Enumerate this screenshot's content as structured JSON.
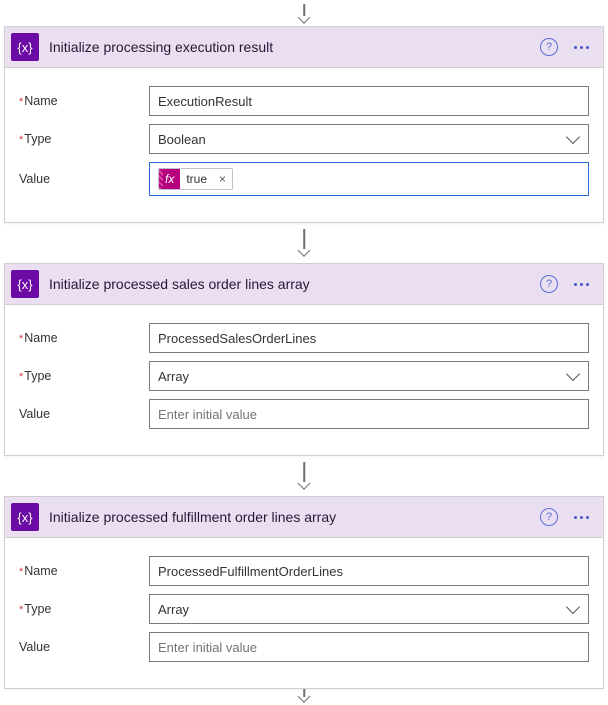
{
  "cards": [
    {
      "title": "Initialize processing execution result",
      "nameLabel": "Name",
      "nameValue": "ExecutionResult",
      "typeLabel": "Type",
      "typeValue": "Boolean",
      "valueLabel": "Value",
      "valueToken": {
        "fx": "fx",
        "text": "true",
        "close": "×"
      },
      "valuePlaceholder": "",
      "valueActive": true
    },
    {
      "title": "Initialize processed sales order lines array",
      "nameLabel": "Name",
      "nameValue": "ProcessedSalesOrderLines",
      "typeLabel": "Type",
      "typeValue": "Array",
      "valueLabel": "Value",
      "valueToken": null,
      "valuePlaceholder": "Enter initial value",
      "valueActive": false
    },
    {
      "title": "Initialize processed fulfillment order lines array",
      "nameLabel": "Name",
      "nameValue": "ProcessedFulfillmentOrderLines",
      "typeLabel": "Type",
      "typeValue": "Array",
      "valueLabel": "Value",
      "valueToken": null,
      "valuePlaceholder": "Enter initial value",
      "valueActive": false
    }
  ]
}
